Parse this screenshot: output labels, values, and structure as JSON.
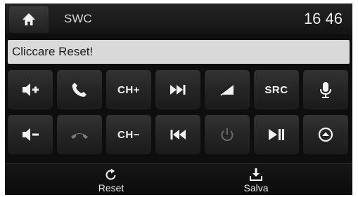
{
  "header": {
    "title": "SWC",
    "time": "16 46"
  },
  "status": {
    "message": "Cliccare Reset!"
  },
  "buttons": {
    "ch_plus": "CH+",
    "ch_minus": "CH−",
    "src": "SRC"
  },
  "footer": {
    "reset_label": "Reset",
    "save_label": "Salva"
  },
  "colors": {
    "background": "#0e0e0e",
    "button": "#2a2a2a",
    "status_bar": "#d9d9d9",
    "icon": "#f2f2f2"
  }
}
